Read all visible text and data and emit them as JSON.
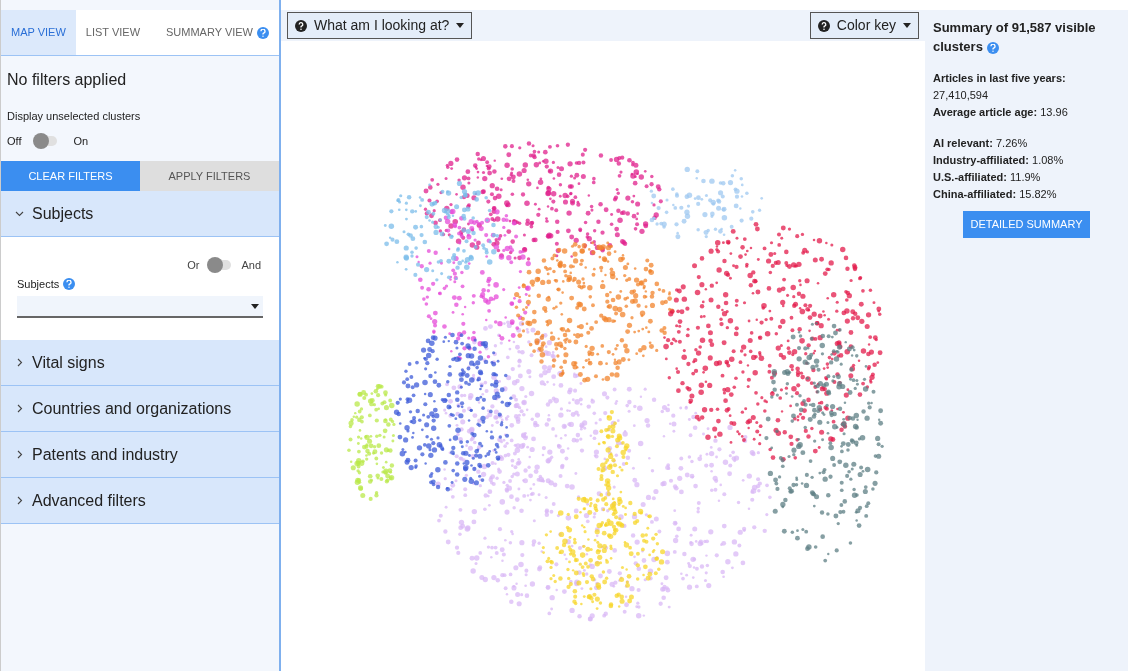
{
  "tabs": [
    {
      "label": "MAP VIEW",
      "selected": true
    },
    {
      "label": "LIST VIEW",
      "selected": false
    },
    {
      "label": "SUMMARY VIEW",
      "selected": false,
      "help": true
    }
  ],
  "filter_status": "No filters applied",
  "display_unselected": {
    "label": "Display unselected clusters",
    "off_label": "Off",
    "on_label": "On",
    "on": false
  },
  "filter_buttons": [
    {
      "label": "CLEAR FILTERS",
      "kind": "primary"
    },
    {
      "label": "APPLY FILTERS",
      "kind": "secondary"
    }
  ],
  "sections": [
    {
      "title": "Subjects",
      "expanded": true,
      "or_label": "Or",
      "and_label": "And",
      "and_on": false,
      "field_label": "Subjects"
    },
    {
      "title": "Vital signs",
      "expanded": false
    },
    {
      "title": "Countries and organizations",
      "expanded": false
    },
    {
      "title": "Patents and industry",
      "expanded": false
    },
    {
      "title": "Advanced filters",
      "expanded": false
    }
  ],
  "map_toolbar": {
    "left_button": "What am I looking at?",
    "right_button": "Color key"
  },
  "summary": {
    "title": "Summary of 91,587 visible clusters",
    "groups": [
      [
        {
          "label": "Articles in last five years:",
          "value": "27,410,594"
        },
        {
          "label": "Average article age:",
          "value": "13.96"
        }
      ],
      [
        {
          "label": "AI relevant:",
          "value": "7.26%"
        },
        {
          "label": "Industry-affiliated:",
          "value": "1.08%"
        },
        {
          "label": "U.S.-affiliated:",
          "value": "11.9%"
        },
        {
          "label": "China-affiliated:",
          "value": "15.82%"
        }
      ]
    ],
    "button": "DETAILED SUMMARY"
  }
}
